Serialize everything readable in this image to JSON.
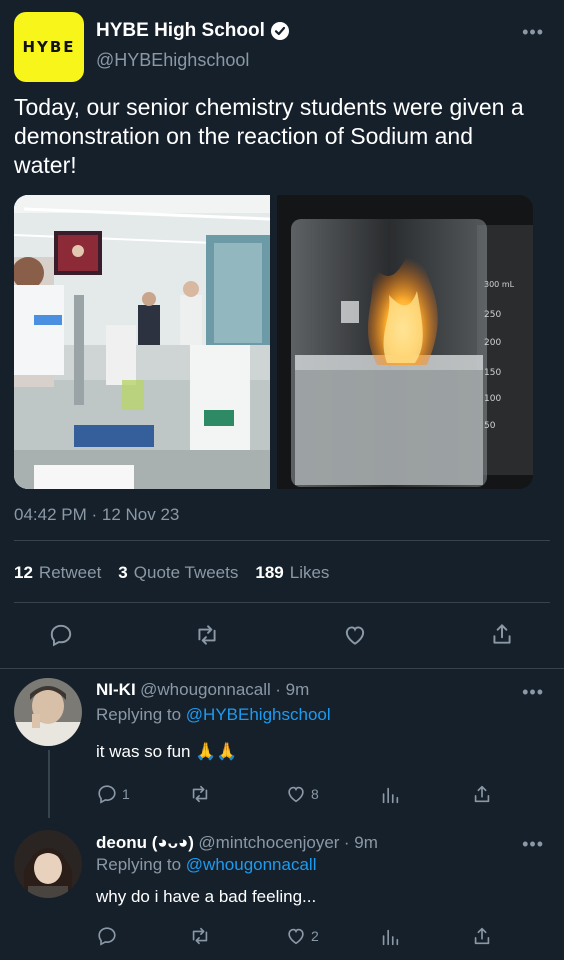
{
  "tweet": {
    "account_name": "HYBE High School",
    "handle": "@HYBEhighschool",
    "logo_text": "HYBE",
    "text": "Today, our senior chemistry students were given a demonstration on the reaction of Sodium and water!",
    "timestamp": "04:42 PM · 12 Nov 23",
    "stats": {
      "retweets_count": "12",
      "retweets_label": "Retweet",
      "quotes_count": "3",
      "quotes_label": "Quote Tweets",
      "likes_count": "189",
      "likes_label": "Likes"
    },
    "images": {
      "beaker_label": "300 mL",
      "beaker_marks": [
        "250",
        "200",
        "150",
        "100",
        "50"
      ]
    }
  },
  "replies": [
    {
      "name": "NI-KI",
      "handle": "@whougonnacall",
      "time": "· 9m",
      "replying_prefix": "Replying to",
      "replying_to": "@HYBEhighschool",
      "text": "it was so fun 🙏🙏",
      "reply_count": "1",
      "like_count": "8"
    },
    {
      "name": "deonu (◕ᴗ◕)",
      "handle": "@mintchocenjoyer",
      "time": "· 9m",
      "replying_prefix": "Replying to",
      "replying_to": "@whougonnacall",
      "text": "why do i have a bad feeling...",
      "reply_count": "",
      "like_count": "2"
    }
  ],
  "colors": {
    "background": "#15202b",
    "accent": "#1d9bf0",
    "muted": "#8b98a5",
    "divider": "#38444d",
    "logo": "#f8f51a"
  }
}
